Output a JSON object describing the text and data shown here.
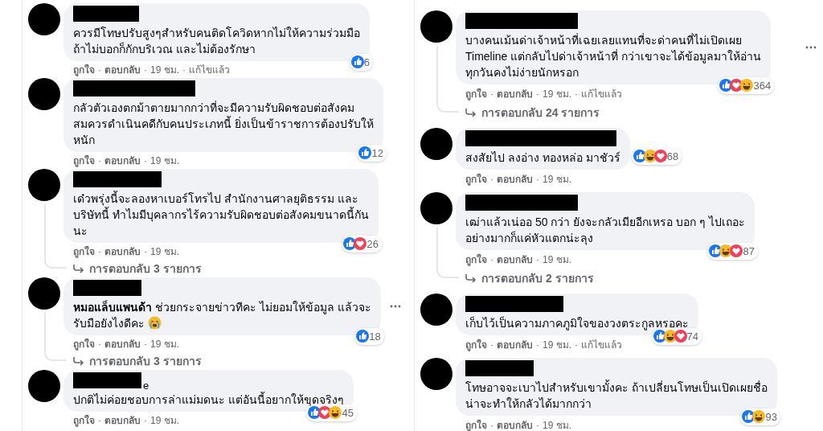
{
  "columns": [
    {
      "comments": [
        {
          "lines": [
            "ควรมีโทษปรับสูงๆสำหรับคนติดโควิดหากไม่ให้ความร่วมมือ",
            "ถ้าไม่บอกก็กักบริเวณ และไม่ต้องรักษา"
          ],
          "reactions": [
            {
              "kind": "like"
            }
          ],
          "count": "6",
          "meta": [
            {
              "kind": "link",
              "text": "ถูกใจ"
            },
            {
              "kind": "sep",
              "text": "·"
            },
            {
              "kind": "link",
              "text": "ตอบกลับ"
            },
            {
              "kind": "sep",
              "text": "·"
            },
            {
              "kind": "info",
              "text": "19 ชม."
            },
            {
              "kind": "sep",
              "text": "·"
            },
            {
              "kind": "info",
              "text": "แก้ไขแล้ว"
            }
          ]
        },
        {
          "lines": [
            "กลัวตัวเองตกม้าตายมากกว่าที่จะมีความรับผิดชอบต่อสังคม",
            "สมควรดำเนินคดีกับคนประเภทนี้ ยิ่งเป็นข้าราชการต้องปรับให้",
            "หนัก"
          ],
          "reactions": [
            {
              "kind": "like"
            }
          ],
          "count": "12",
          "meta": [
            {
              "kind": "link",
              "text": "ถูกใจ"
            },
            {
              "kind": "sep",
              "text": "·"
            },
            {
              "kind": "link",
              "text": "ตอบกลับ"
            },
            {
              "kind": "sep",
              "text": "·"
            },
            {
              "kind": "info",
              "text": "19 ชม."
            }
          ]
        },
        {
          "lines": [
            "เด๋วพรุ่งนี้จะลองหาเบอร์โทรไป สำนักงานศาลยุติธรรม และ",
            "บริษัทนี้ ทำไมมีบุคลากรไร้ความรับผิดชอบต่อสังคมขนาดนี้กัน",
            "นะ"
          ],
          "reactions": [
            {
              "kind": "like"
            },
            {
              "kind": "love"
            }
          ],
          "count": "26",
          "meta": [
            {
              "kind": "link",
              "text": "ถูกใจ"
            },
            {
              "kind": "sep",
              "text": "·"
            },
            {
              "kind": "link",
              "text": "ตอบกลับ"
            },
            {
              "kind": "sep",
              "text": "·"
            },
            {
              "kind": "info",
              "text": "19 ชม."
            }
          ],
          "replies": "การตอบกลับ 3 รายการ"
        },
        {
          "lines": [
            "**หมอแล็บแพนด้า** ช่วยกระจายข่าวทีคะ ไม่ยอมให้ข้อมูล แล้วจะ",
            "รับมือยังไงดีคะ"
          ],
          "trailing_emoji": true,
          "more": true,
          "reactions": [
            {
              "kind": "like"
            }
          ],
          "count": "18",
          "meta": [
            {
              "kind": "link",
              "text": "ถูกใจ"
            },
            {
              "kind": "sep",
              "text": "·"
            },
            {
              "kind": "link",
              "text": "ตอบกลับ"
            },
            {
              "kind": "sep",
              "text": "·"
            },
            {
              "kind": "info",
              "text": "19 ชม."
            }
          ],
          "replies": "การตอบกลับ 3 รายการ"
        },
        {
          "name_tail": "e",
          "lines": [
            "ปกติไม่ค่อยชอบการล่าแม่มดนะ แต่อันนี้อยากให้ขุดจริงๆ"
          ],
          "reactions": [
            {
              "kind": "like"
            },
            {
              "kind": "love"
            },
            {
              "kind": "haha"
            }
          ],
          "count": "45",
          "meta": [
            {
              "kind": "link",
              "text": "ถูกใจ"
            },
            {
              "kind": "sep",
              "text": "·"
            },
            {
              "kind": "link",
              "text": "ตอบกลับ"
            },
            {
              "kind": "sep",
              "text": "·"
            },
            {
              "kind": "info",
              "text": "19 ชม."
            }
          ]
        }
      ]
    },
    {
      "comments": [
        {
          "lines": [
            "บางคนเม้นด่าเจ้าหน้าที่เฉยเลยแทนที่จะด่าคนที่ไม่เปิดเผย",
            "Timeline แต่กลับไปด่าเจ้าหน้าที่ กว่าเขาจะได้ข้อมูลมาให้อ่าน",
            "ทุกวันคงไม่ง่ายนักหรอก"
          ],
          "more": true,
          "reactions": [
            {
              "kind": "like"
            },
            {
              "kind": "love"
            },
            {
              "kind": "haha"
            }
          ],
          "count": "364",
          "meta": [
            {
              "kind": "link",
              "text": "ถูกใจ"
            },
            {
              "kind": "sep",
              "text": "·"
            },
            {
              "kind": "link",
              "text": "ตอบกลับ"
            },
            {
              "kind": "sep",
              "text": "·"
            },
            {
              "kind": "info",
              "text": "19 ชม."
            },
            {
              "kind": "sep",
              "text": "·"
            },
            {
              "kind": "info",
              "text": "แก้ไขแล้ว"
            }
          ],
          "replies": "การตอบกลับ 24 รายการ"
        },
        {
          "lines": [
            "สงสัยไป ลงอ่าง ทองหล่อ มาชัวร์"
          ],
          "reactions": [
            {
              "kind": "like"
            },
            {
              "kind": "haha"
            },
            {
              "kind": "love"
            }
          ],
          "count": "68",
          "meta": [
            {
              "kind": "link",
              "text": "ถูกใจ"
            },
            {
              "kind": "sep",
              "text": "·"
            },
            {
              "kind": "link",
              "text": "ตอบกลับ"
            },
            {
              "kind": "sep",
              "text": "·"
            },
            {
              "kind": "info",
              "text": "19 ชม."
            }
          ]
        },
        {
          "lines": [
            "เฒ่าแล้วเน่ออ 50 กว่า ยังจะกลัวเมียอีกเหรอ บอก ๆ ไปเถอะ",
            "อย่างมากก็แค่หัวแตกน่ะลุง"
          ],
          "reactions": [
            {
              "kind": "like"
            },
            {
              "kind": "haha"
            },
            {
              "kind": "love"
            }
          ],
          "count": "87",
          "meta": [
            {
              "kind": "link",
              "text": "ถูกใจ"
            },
            {
              "kind": "sep",
              "text": "·"
            },
            {
              "kind": "link",
              "text": "ตอบกลับ"
            },
            {
              "kind": "sep",
              "text": "·"
            },
            {
              "kind": "info",
              "text": "19 ชม."
            }
          ],
          "replies": "การตอบกลับ 2 รายการ"
        },
        {
          "lines": [
            "เก็บไว้เป็นความภาคภูมิใจของวงตระกูลหรอคะ"
          ],
          "reactions": [
            {
              "kind": "like"
            },
            {
              "kind": "haha"
            },
            {
              "kind": "love"
            }
          ],
          "count": "74",
          "meta": [
            {
              "kind": "link",
              "text": "ถูกใจ"
            },
            {
              "kind": "sep",
              "text": "·"
            },
            {
              "kind": "link",
              "text": "ตอบกลับ"
            },
            {
              "kind": "sep",
              "text": "·"
            },
            {
              "kind": "info",
              "text": "19 ชม."
            },
            {
              "kind": "sep",
              "text": "·"
            },
            {
              "kind": "info",
              "text": "แก้ไขแล้ว"
            }
          ]
        },
        {
          "lines": [
            "โทษอาจจะเบาไปสำหรับเขามั้งคะ ถ้าเปลี่ยนโทษเป็นเปิดเผยชื่อ",
            "น่าจะทำให้กลัวได้มากกว่า"
          ],
          "reactions": [
            {
              "kind": "like"
            },
            {
              "kind": "haha"
            }
          ],
          "count": "93",
          "meta": [
            {
              "kind": "link",
              "text": "ถูกใจ"
            },
            {
              "kind": "sep",
              "text": "·"
            },
            {
              "kind": "link",
              "text": "ตอบกลับ"
            },
            {
              "kind": "sep",
              "text": "·"
            },
            {
              "kind": "info",
              "text": "19 ชม."
            }
          ]
        }
      ]
    }
  ]
}
